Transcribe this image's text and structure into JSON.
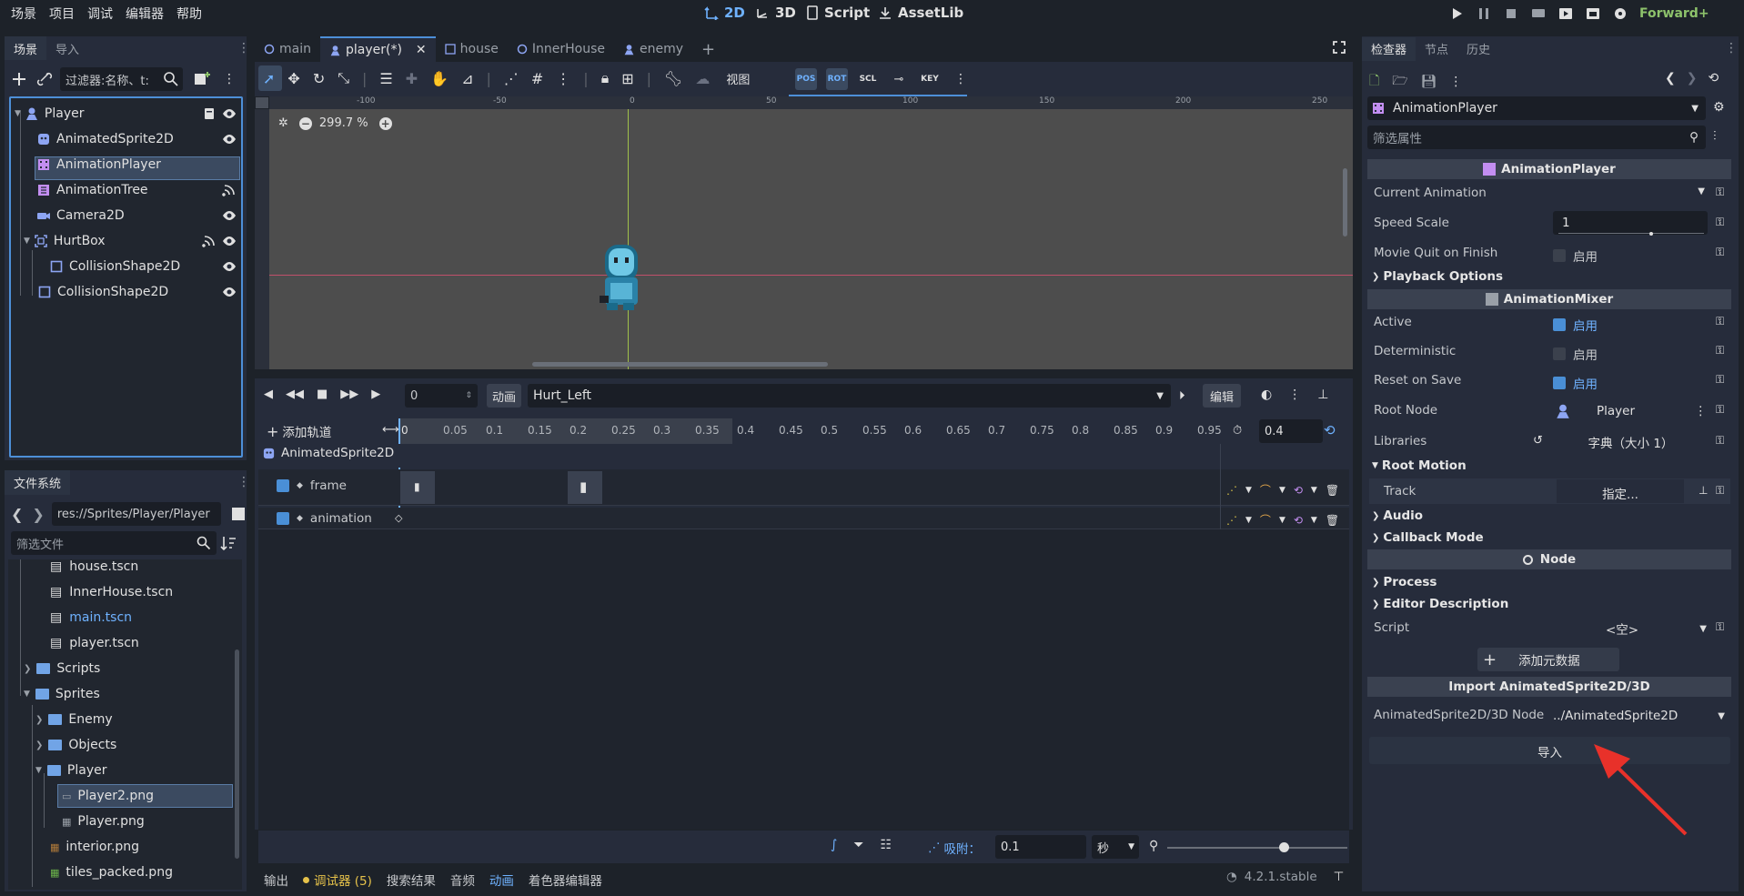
{
  "menu": [
    "场景",
    "项目",
    "调试",
    "编辑器",
    "帮助"
  ],
  "workspaces": {
    "w2d": "2D",
    "w3d": "3D",
    "script": "Script",
    "assetlib": "AssetLib"
  },
  "renderer": "Forward+",
  "scene_dock": {
    "tabs": [
      "场景",
      "导入"
    ],
    "filter_placeholder": "过滤器:名称、t:",
    "nodes": [
      {
        "label": "Player"
      },
      {
        "label": "AnimatedSprite2D"
      },
      {
        "label": "AnimationPlayer"
      },
      {
        "label": "AnimationTree"
      },
      {
        "label": "Camera2D"
      },
      {
        "label": "HurtBox"
      },
      {
        "label": "CollisionShape2D"
      },
      {
        "label": "CollisionShape2D"
      }
    ]
  },
  "filesystem": {
    "title": "文件系统",
    "path": "res://Sprites/Player/Player",
    "filter_placeholder": "筛选文件",
    "items": [
      {
        "label": "house.tscn"
      },
      {
        "label": "InnerHouse.tscn"
      },
      {
        "label": "main.tscn"
      },
      {
        "label": "player.tscn"
      },
      {
        "label": "Scripts"
      },
      {
        "label": "Sprites"
      },
      {
        "label": "Enemy"
      },
      {
        "label": "Objects"
      },
      {
        "label": "Player"
      },
      {
        "label": "Player2.png"
      },
      {
        "label": "Player.png"
      },
      {
        "label": "interior.png"
      },
      {
        "label": "tiles_packed.png"
      }
    ]
  },
  "editor_tabs": [
    {
      "label": "main"
    },
    {
      "label": "player(*)"
    },
    {
      "label": "house"
    },
    {
      "label": "InnerHouse"
    },
    {
      "label": "enemy"
    }
  ],
  "toolbar": {
    "view": "视图"
  },
  "viewport": {
    "zoom": "299.7 %",
    "ruler_labels": [
      "-100",
      "-50",
      "0",
      "50",
      "100",
      "150",
      "200",
      "250"
    ]
  },
  "animation": {
    "time_value": "0",
    "anim_label": "动画",
    "anim_name": "Hurt_Left",
    "edit_label": "编辑",
    "add_track": "添加轨道",
    "timeline": [
      "0",
      "0.05",
      "0.1",
      "0.15",
      "0.2",
      "0.25",
      "0.3",
      "0.35",
      "0.4",
      "0.45",
      "0.5",
      "0.55",
      "0.6",
      "0.65",
      "0.7",
      "0.75",
      "0.8",
      "0.85",
      "0.9",
      "0.95"
    ],
    "length": "0.4",
    "node_track": "AnimatedSprite2D",
    "tracks": [
      {
        "label": "frame"
      },
      {
        "label": "animation"
      }
    ],
    "snap_label": "吸附：",
    "snap_value": "0.1",
    "snap_unit": "秒"
  },
  "bottom_panel": {
    "tabs": [
      "输出",
      "调试器 (5)",
      "搜索结果",
      "音频",
      "动画",
      "着色器编辑器"
    ],
    "version": "4.2.1.stable"
  },
  "inspector": {
    "tabs": [
      "检查器",
      "节点",
      "历史"
    ],
    "node_name": "AnimationPlayer",
    "filter_placeholder": "筛选属性",
    "sec_animplayer": "AnimationPlayer",
    "current_animation": "Current Animation",
    "speed_scale": "Speed Scale",
    "speed_scale_value": "1",
    "movie_quit": "Movie Quit on Finish",
    "enabled": "启用",
    "playback_options": "Playback Options",
    "sec_mixer": "AnimationMixer",
    "active": "Active",
    "deterministic": "Deterministic",
    "reset_on_save": "Reset on Save",
    "root_node": "Root Node",
    "root_node_value": "Player",
    "libraries": "Libraries",
    "libraries_value": "字典（大小 1）",
    "root_motion": "Root Motion",
    "track": "Track",
    "track_value": "指定...",
    "audio": "Audio",
    "callback_mode": "Callback Mode",
    "sec_node": "Node",
    "process": "Process",
    "editor_description": "Editor Description",
    "script": "Script",
    "script_value": "<空>",
    "add_metadata": "添加元数据",
    "sec_import": "Import AnimatedSprite2D/3D",
    "import_node_label": "AnimatedSprite2D/3D Node",
    "import_node_value": "../AnimatedSprite2D",
    "import_button": "导入"
  },
  "colors": {
    "accent": "#6fb2ff",
    "annotation_arrow": "#e8312a"
  }
}
